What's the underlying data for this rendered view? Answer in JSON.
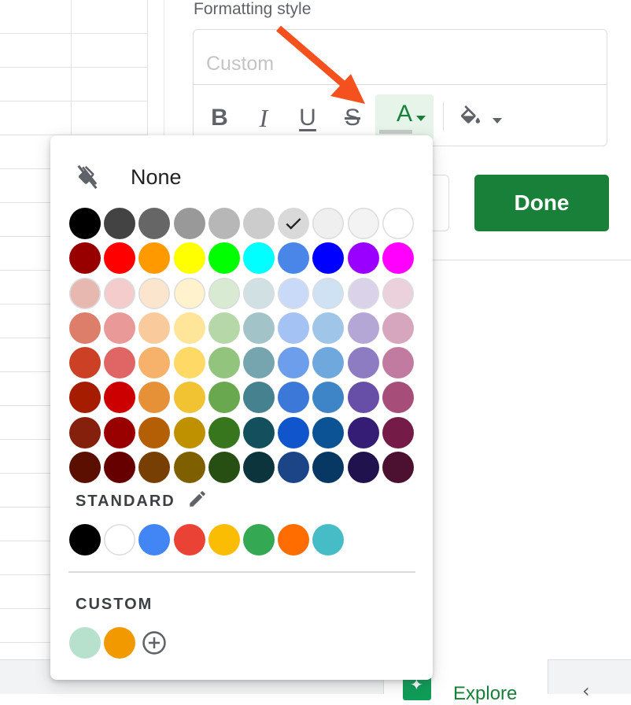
{
  "formatting": {
    "label": "Formatting style",
    "style_placeholder": "Custom",
    "toolbar": {
      "bold": "B",
      "italic": "I",
      "underline": "U",
      "strikethrough": "S",
      "text_color": "A"
    }
  },
  "actions": {
    "done_label": "Done"
  },
  "bottom": {
    "explore_label": "Explore"
  },
  "picker": {
    "none_label": "None",
    "standard_label": "STANDARD",
    "custom_label": "CUSTOM",
    "selected_color": "#d9d9d9",
    "palette": [
      [
        "#000000",
        "#434343",
        "#666666",
        "#999999",
        "#b7b7b7",
        "#cccccc",
        "#d9d9d9",
        "#efefef",
        "#f3f3f3",
        "#ffffff"
      ],
      [
        "#980000",
        "#ff0000",
        "#ff9900",
        "#ffff00",
        "#00ff00",
        "#00ffff",
        "#4a86e8",
        "#0000ff",
        "#9900ff",
        "#ff00ff"
      ],
      [
        "#e6b8af",
        "#f4cccc",
        "#fce5cd",
        "#fff2cc",
        "#d9ead3",
        "#d0e0e3",
        "#c9daf8",
        "#cfe2f3",
        "#d9d2e9",
        "#ead1dc"
      ],
      [
        "#dd7e6b",
        "#ea9999",
        "#f9cb9c",
        "#ffe599",
        "#b6d7a8",
        "#a2c4c9",
        "#a4c2f4",
        "#9fc5e8",
        "#b4a7d6",
        "#d5a6bd"
      ],
      [
        "#cc4125",
        "#e06666",
        "#f6b26b",
        "#ffd966",
        "#93c47d",
        "#76a5af",
        "#6d9eeb",
        "#6fa8dc",
        "#8e7cc3",
        "#c27ba0"
      ],
      [
        "#a61c00",
        "#cc0000",
        "#e69138",
        "#f1c232",
        "#6aa84f",
        "#45818e",
        "#3c78d8",
        "#3d85c6",
        "#674ea7",
        "#a64d79"
      ],
      [
        "#85200c",
        "#990000",
        "#b45f06",
        "#bf9000",
        "#38761d",
        "#134f5c",
        "#1155cc",
        "#0b5394",
        "#351c75",
        "#741b47"
      ],
      [
        "#5b0f00",
        "#660000",
        "#783f04",
        "#7f6000",
        "#274e13",
        "#0c343d",
        "#1c4587",
        "#073763",
        "#20124d",
        "#4c1130"
      ]
    ],
    "standard": [
      "#000000",
      "#ffffff",
      "#4285f4",
      "#ea4335",
      "#fbbc04",
      "#34a853",
      "#ff6d01",
      "#46bdc6"
    ],
    "custom": [
      "#b7e1cd",
      "#f29900"
    ]
  },
  "colors": {
    "accent_green": "#188038",
    "annotation_arrow": "#f4511e"
  }
}
